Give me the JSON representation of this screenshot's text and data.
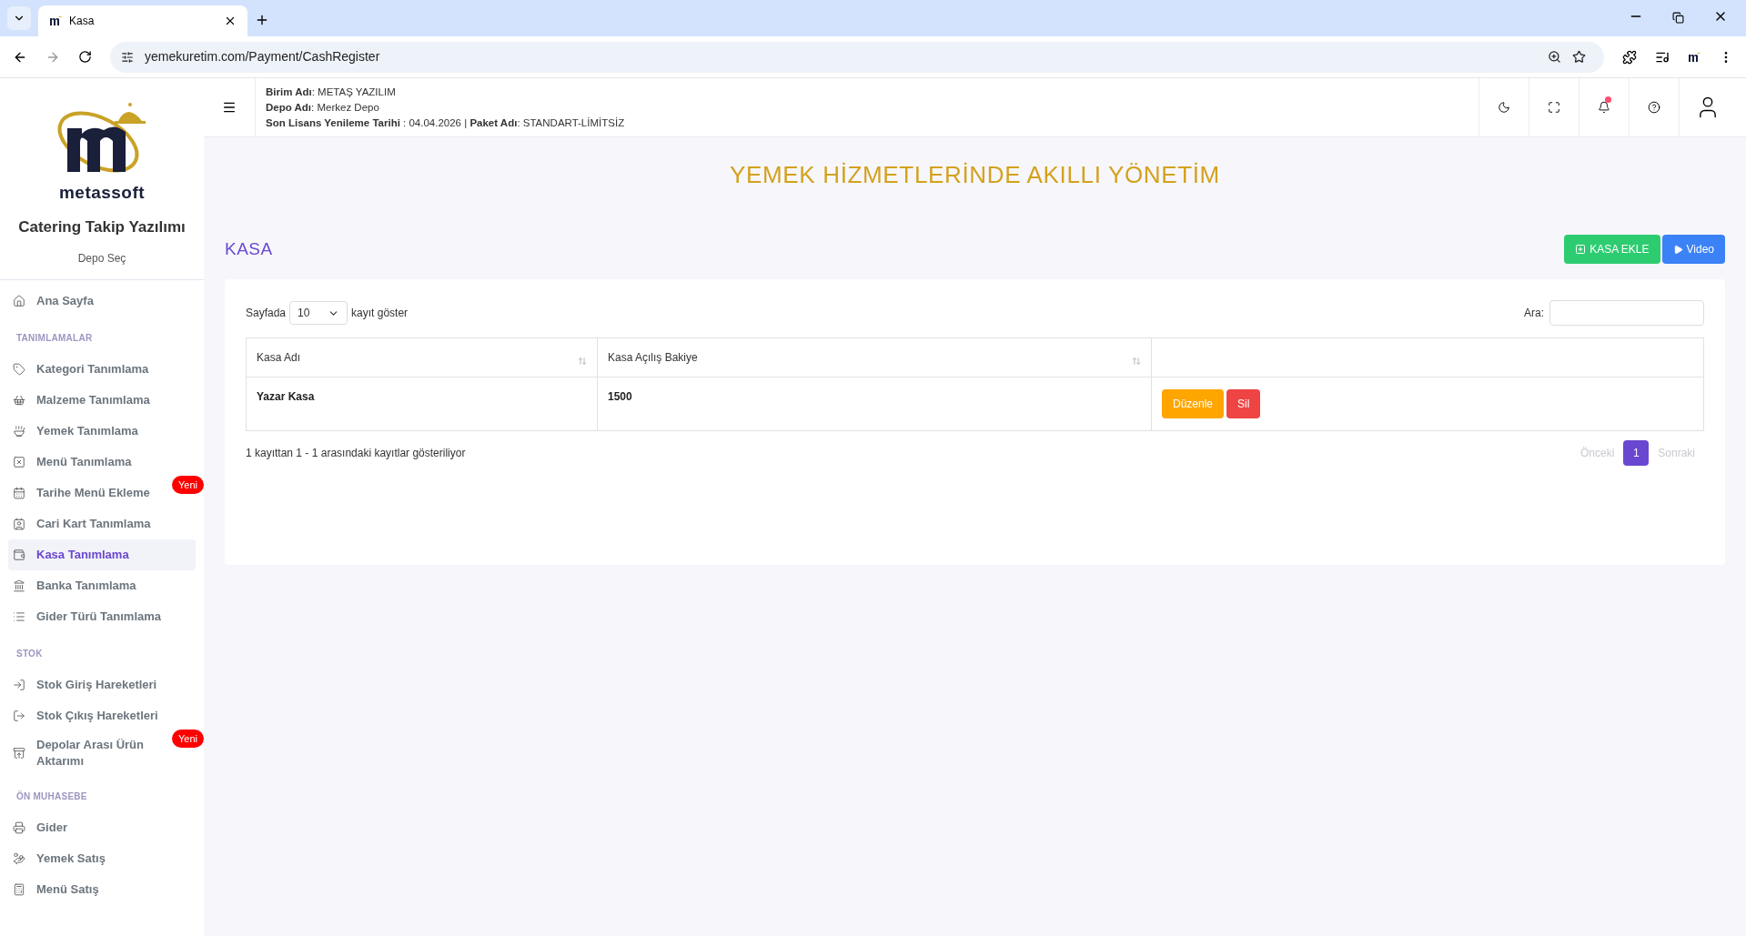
{
  "browser": {
    "tab_title": "Kasa",
    "url": "yemekuretim.com/Payment/CashRegister"
  },
  "sidebar": {
    "brand": "metassoft",
    "app_name": "Catering Takip Yazılımı",
    "depot_link": "Depo Seç",
    "items": [
      {
        "kind": "item",
        "label": "Ana Sayfa",
        "selected": false
      },
      {
        "kind": "section",
        "label": "TANIMLAMALAR"
      },
      {
        "kind": "item",
        "label": "Kategori Tanımlama",
        "selected": false
      },
      {
        "kind": "item",
        "label": "Malzeme Tanımlama",
        "selected": false
      },
      {
        "kind": "item",
        "label": "Yemek Tanımlama",
        "selected": false
      },
      {
        "kind": "item",
        "label": "Menü Tanımlama",
        "selected": false
      },
      {
        "kind": "item",
        "label": "Tarihe Menü Ekleme",
        "selected": false,
        "badge": "Yeni"
      },
      {
        "kind": "item",
        "label": "Cari Kart Tanımlama",
        "selected": false
      },
      {
        "kind": "item",
        "label": "Kasa Tanımlama",
        "selected": true
      },
      {
        "kind": "item",
        "label": "Banka Tanımlama",
        "selected": false
      },
      {
        "kind": "item",
        "label": "Gider Türü Tanımlama",
        "selected": false
      },
      {
        "kind": "section",
        "label": "STOK"
      },
      {
        "kind": "item",
        "label": "Stok Giriş Hareketleri",
        "selected": false
      },
      {
        "kind": "item",
        "label": "Stok Çıkış Hareketleri",
        "selected": false
      },
      {
        "kind": "item",
        "label": "Depolar Arası Ürün Aktarımı",
        "selected": false,
        "badge": "Yeni"
      },
      {
        "kind": "section",
        "label": "ÖN MUHASEBE"
      },
      {
        "kind": "item",
        "label": "Gider",
        "selected": false
      },
      {
        "kind": "item",
        "label": "Yemek Satış",
        "selected": false
      },
      {
        "kind": "item",
        "label": "Menü Satış",
        "selected": false
      }
    ]
  },
  "header": {
    "lines": [
      [
        {
          "label": "Birim Adı",
          "value": ": METAŞ YAZILIM"
        }
      ],
      [
        {
          "label": "Depo Adı",
          "value": ": Merkez Depo"
        }
      ],
      [
        {
          "label": "Son Lisans Yenileme Tarihi",
          "value": " : 04.04.2026 | "
        },
        {
          "label": "Paket Adı",
          "value": ": STANDART-LİMİTSİZ"
        }
      ]
    ]
  },
  "banner": "YEMEK HİZMETLERİNDE AKILLI YÖNETİM",
  "page_title": "KASA",
  "actions": [
    {
      "kind": "add",
      "label": "KASA EKLE"
    },
    {
      "kind": "video",
      "label": "Video"
    }
  ],
  "table_controls": {
    "prefix": "Sayfada",
    "page_size": "10",
    "suffix": "kayıt göster",
    "search_label": "Ara:"
  },
  "table": {
    "columns": [
      "Kasa Adı",
      "Kasa Açılış Bakiye"
    ],
    "rows": [
      {
        "cells": [
          "Yazar Kasa",
          "1500"
        ],
        "buttons": [
          {
            "kind": "edit",
            "label": "Düzenle"
          },
          {
            "kind": "delete",
            "label": "Sil"
          }
        ]
      }
    ]
  },
  "footer": {
    "info": "1 kayıttan 1 - 1 arasındaki kayıtlar gösteriliyor",
    "prev": "Önceki",
    "pages": [
      {
        "label": "1",
        "selected": true
      }
    ],
    "next": "Sonraki"
  }
}
